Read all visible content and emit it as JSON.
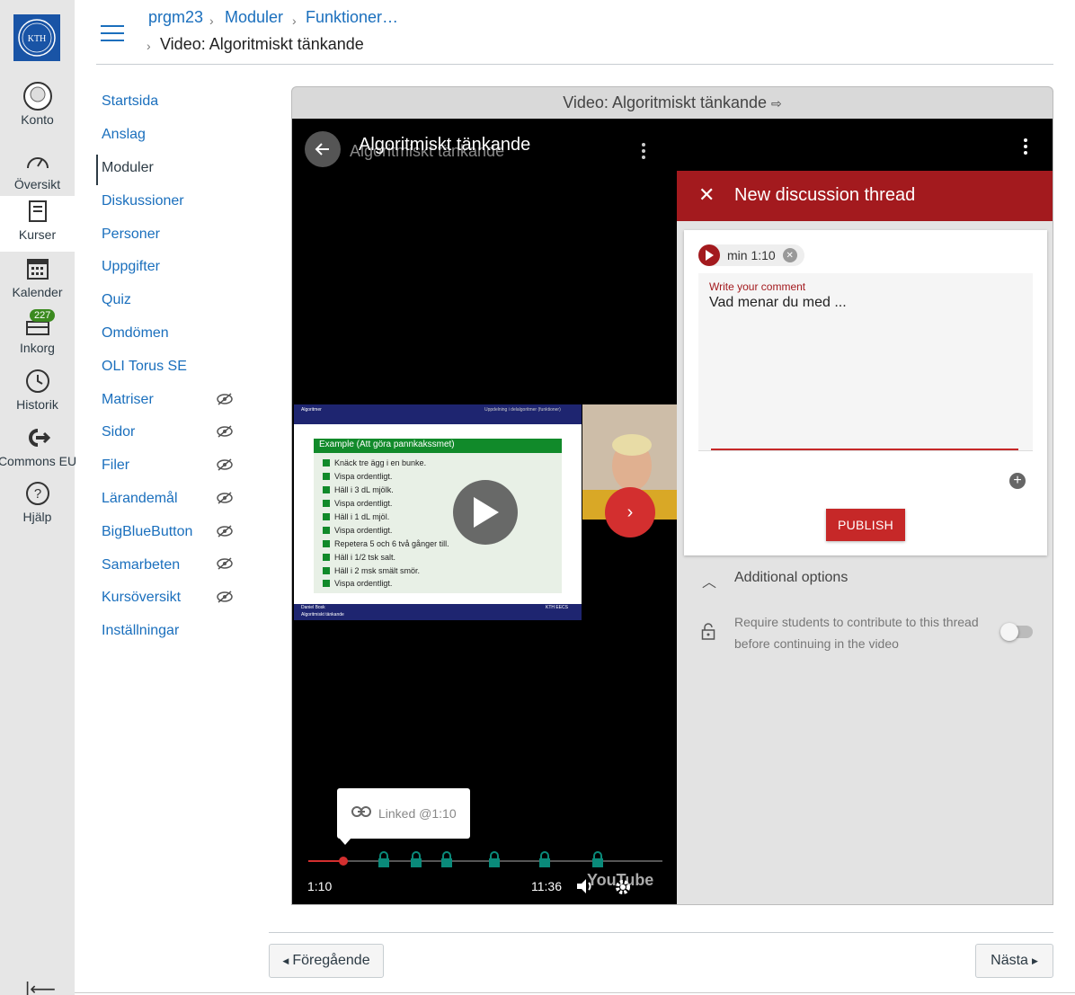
{
  "global_nav": {
    "items": [
      {
        "label": "Konto",
        "icon": "account-icon"
      },
      {
        "label": "Översikt",
        "icon": "dashboard-icon"
      },
      {
        "label": "Kurser",
        "icon": "courses-icon"
      },
      {
        "label": "Kalender",
        "icon": "calendar-icon"
      },
      {
        "label": "Inkorg",
        "icon": "inbox-icon"
      },
      {
        "label": "Historik",
        "icon": "history-icon"
      },
      {
        "label": "Commons EU",
        "icon": "commons-icon"
      },
      {
        "label": "Hjälp",
        "icon": "help-icon"
      }
    ],
    "inbox_badge": "227",
    "logo_text": "KTH"
  },
  "breadcrumb": {
    "items": [
      "prgm23",
      "Moduler",
      "Funktioner…"
    ],
    "current": "Video: Algoritmiskt tänkande"
  },
  "course_nav": {
    "items": [
      {
        "label": "Startsida"
      },
      {
        "label": "Anslag"
      },
      {
        "label": "Moduler"
      },
      {
        "label": "Diskussioner"
      },
      {
        "label": "Personer"
      },
      {
        "label": "Uppgifter"
      },
      {
        "label": "Quiz"
      },
      {
        "label": "Omdömen"
      },
      {
        "label": "OLI Torus SE"
      },
      {
        "label": "Matriser"
      },
      {
        "label": "Sidor"
      },
      {
        "label": "Filer"
      },
      {
        "label": "Lärandemål"
      },
      {
        "label": "BigBlueButton"
      },
      {
        "label": "Samarbeten"
      },
      {
        "label": "Kursöversikt"
      },
      {
        "label": "Inställningar"
      }
    ]
  },
  "content": {
    "frame_title": "Video: Algoritmiskt tänkande",
    "video": {
      "title": "Algoritmiskt tänkande",
      "current_time": "1:10",
      "duration": "11:36",
      "progress": 0.1,
      "tooltip": "Linked @1:10",
      "youtube": "YouTube",
      "slide": {
        "heading": "Example (Att göra pannkakssmet)",
        "header_left": "Algoritmer",
        "header_right": "Uppdelning i delalgoritmer (funktioner)",
        "footer_left": "Daniel Bosk",
        "footer_left2": "Algoritmiskt tänkande",
        "footer_right": "KTH EECS",
        "steps": [
          "Knäck tre ägg i en bunke.",
          "Vispa ordentligt.",
          "Häll i 3 dL mjölk.",
          "Vispa ordentligt.",
          "Häll i 1 dL mjöl.",
          "Vispa ordentligt.",
          "Repetera 5 och 6 två gånger till.",
          "Häll i 1/2 tsk salt.",
          "Häll i 2 msk smält smör.",
          "Vispa ordentligt."
        ]
      }
    },
    "discussion": {
      "title": "New discussion thread",
      "timestamp_chip": "min 1:10",
      "comment_label": "Write your comment",
      "comment_value": "Vad menar du med ...",
      "publish": "PUBLISH",
      "additional_options": "Additional options",
      "require_text": "Require students to contribute to this thread before continuing in the video"
    }
  },
  "footer": {
    "prev": "Föregående",
    "next": "Nästa"
  },
  "colors": {
    "link": "#1a6fbd",
    "accent_red": "#a31a1e",
    "kth_blue": "#1954a6"
  }
}
